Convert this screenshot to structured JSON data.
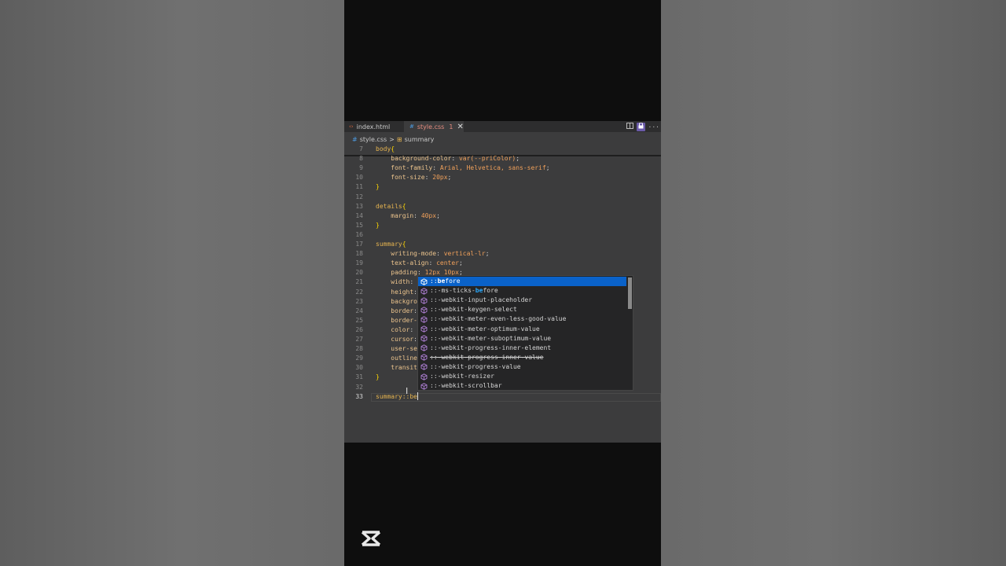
{
  "tabs": [
    {
      "icon": "html-file-icon",
      "icon_glyph": "‹›",
      "label": "index.html"
    },
    {
      "icon": "css-file-icon",
      "icon_glyph": "#",
      "label": "style.css",
      "count": "1",
      "close": "✕"
    }
  ],
  "breadcrumb": {
    "file": "style.css",
    "separator": ">",
    "symbol": "summary"
  },
  "code_lines": [
    {
      "n": "7",
      "text": "body{"
    },
    {
      "n": "8",
      "text": "    background-color: var(--priColor);"
    },
    {
      "n": "9",
      "text": "    font-family: Arial, Helvetica, sans-serif;"
    },
    {
      "n": "10",
      "text": "    font-size: 20px;"
    },
    {
      "n": "11",
      "text": "}"
    },
    {
      "n": "12",
      "text": ""
    },
    {
      "n": "13",
      "text": "details{"
    },
    {
      "n": "14",
      "text": "    margin: 40px;"
    },
    {
      "n": "15",
      "text": "}"
    },
    {
      "n": "16",
      "text": ""
    },
    {
      "n": "17",
      "text": "summary{"
    },
    {
      "n": "18",
      "text": "    writing-mode: vertical-lr;"
    },
    {
      "n": "19",
      "text": "    text-align: center;"
    },
    {
      "n": "20",
      "text": "    padding: 12px 10px;"
    },
    {
      "n": "21",
      "text": "    width:"
    },
    {
      "n": "22",
      "text": "    height:"
    },
    {
      "n": "23",
      "text": "    backgro"
    },
    {
      "n": "24",
      "text": "    border:"
    },
    {
      "n": "25",
      "text": "    border-"
    },
    {
      "n": "26",
      "text": "    color:"
    },
    {
      "n": "27",
      "text": "    cursor:"
    },
    {
      "n": "28",
      "text": "    user-se"
    },
    {
      "n": "29",
      "text": "    outline"
    },
    {
      "n": "30",
      "text": "    transit"
    },
    {
      "n": "31",
      "text": "}"
    },
    {
      "n": "32",
      "text": ""
    },
    {
      "n": "33",
      "text": "summary::be"
    }
  ],
  "suggestions": [
    {
      "label": "::before",
      "match": "be",
      "selected": true,
      "deprecated": false
    },
    {
      "label": "::-ms-ticks-before",
      "match": "be",
      "selected": false,
      "deprecated": false
    },
    {
      "label": "::-webkit-input-placeholder",
      "match": "be",
      "selected": false,
      "deprecated": false
    },
    {
      "label": "::-webkit-keygen-select",
      "match": "be",
      "selected": false,
      "deprecated": false
    },
    {
      "label": "::-webkit-meter-even-less-good-value",
      "match": "be",
      "selected": false,
      "deprecated": false
    },
    {
      "label": "::-webkit-meter-optimum-value",
      "match": "be",
      "selected": false,
      "deprecated": false
    },
    {
      "label": "::-webkit-meter-suboptimum-value",
      "match": "be",
      "selected": false,
      "deprecated": false
    },
    {
      "label": "::-webkit-progress-inner-element",
      "match": "be",
      "selected": false,
      "deprecated": false
    },
    {
      "label": "::-webkit-progress-inner-value",
      "match": "be",
      "selected": false,
      "deprecated": true
    },
    {
      "label": "::-webkit-progress-value",
      "match": "be",
      "selected": false,
      "deprecated": false
    },
    {
      "label": "::-webkit-resizer",
      "match": "be",
      "selected": false,
      "deprecated": false
    },
    {
      "label": "::-webkit-scrollbar",
      "match": "be",
      "selected": false,
      "deprecated": false
    }
  ],
  "colors": {
    "selection": "#0a62c9",
    "editor_bg": "#3c3c3d",
    "selector": "#e6b450",
    "value": "#f0a05a"
  },
  "watermark_icon": "capcut-logo-icon"
}
